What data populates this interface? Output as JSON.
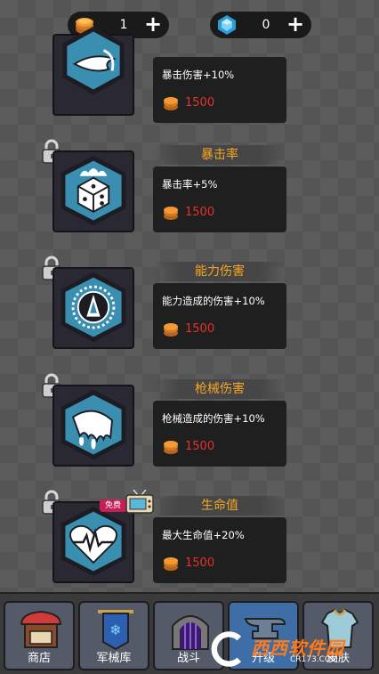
{
  "currency": {
    "coins": {
      "icon": "coin-stack-icon",
      "value": "1"
    },
    "gems": {
      "icon": "blue-gem-icon",
      "value": "0"
    }
  },
  "upgrades": [
    {
      "icon": "crit-damage-icon",
      "title": "",
      "desc": "暴击伤害+10%",
      "price": "1500",
      "locked": false
    },
    {
      "icon": "crit-rate-dice-icon",
      "title": "暴击率",
      "desc": "暴击率+5%",
      "price": "1500",
      "locked": true
    },
    {
      "icon": "ability-damage-icon",
      "title": "能力伤害",
      "desc": "能力造成的伤害+10%",
      "price": "1500",
      "locked": true
    },
    {
      "icon": "gun-damage-icon",
      "title": "枪械伤害",
      "desc": "枪械造成的伤害+10%",
      "price": "1500",
      "locked": true
    },
    {
      "icon": "heart-health-icon",
      "title": "生命值",
      "desc": "最大生命值+20%",
      "price": "1500",
      "locked": true
    }
  ],
  "free_badge": "免费",
  "nav": [
    {
      "label": "商店",
      "icon": "shop-icon",
      "active": false
    },
    {
      "label": "军械库",
      "icon": "armory-banner-icon",
      "active": false
    },
    {
      "label": "战斗",
      "icon": "battle-gate-icon",
      "active": false
    },
    {
      "label": "升级",
      "icon": "anvil-icon",
      "active": true
    },
    {
      "label": "皮肤",
      "icon": "armor-skin-icon",
      "active": false
    }
  ],
  "watermark": {
    "main": "西西软件园",
    "sub": "CR173.COM"
  },
  "colors": {
    "accent_title": "#f5a623",
    "price_red": "#e8312a",
    "hex_blue": "#3a8fb0",
    "active_nav": "#3f6ea6"
  }
}
